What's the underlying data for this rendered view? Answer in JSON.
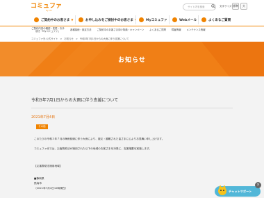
{
  "header": {
    "logo": "コミュファ",
    "logo_sub": "by ctc",
    "search_placeholder": "サイト内を検索",
    "font_size_label": "文字サイズ",
    "font_sizes": [
      "標準",
      "大"
    ]
  },
  "main_nav": [
    {
      "label": "ご契約中のお客さま",
      "chevron": "▼"
    },
    {
      "label": "お申し込みをご検討中のお客さま",
      "chevron": "▼"
    },
    {
      "label": "Myコミュファ",
      "chevron": ""
    },
    {
      "label": "Webメール",
      "chevron": ""
    },
    {
      "label": "よくあるご質問",
      "chevron": ""
    }
  ],
  "sub_nav": [
    "ご契約内容の確認・変更・お手続き「Myコミュファ」",
    "各種接続・設定方法",
    "ご契約中のお客さま向け特典・キャンペーン",
    "よくあるご質問",
    "障害情報",
    "メンテナンス情報"
  ],
  "breadcrumb": [
    "コミュファ光 公式サイト",
    ">",
    "お知らせ",
    ">",
    "令和3年7月1日からの大雨に伴う支援について"
  ],
  "banner": {
    "title": "お知らせ"
  },
  "article": {
    "title": "令和3年7月1日からの大雨に伴う支援について",
    "date": "2021年7月4日",
    "badge": "その他",
    "lines": [
      "このたびの令和３年７月の梅雨前線に伴う大雨により、被災・避難された皆さまに心よりお見舞い申し上げます。",
      "コミュファ光では、災害救助法が適用された以下の地域のお客さまを対象に、支援措置を実施します。",
      "【災害救助法適用地域】",
      "■静岡県",
      "熱海市",
      "（2021年7月4日12時現在）"
    ]
  },
  "chat": {
    "label": "チャットサポート",
    "close": "×"
  }
}
